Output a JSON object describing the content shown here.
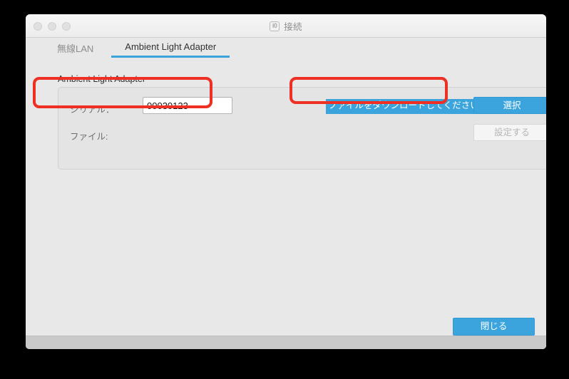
{
  "window": {
    "title": "接続",
    "title_icon": "app-window-icon",
    "traffic_lights": [
      "close-button",
      "minimize-button",
      "maximize-button"
    ]
  },
  "tabs": [
    {
      "label": "無線LAN",
      "active": false
    },
    {
      "label": "Ambient Light Adapter",
      "active": true
    }
  ],
  "section": {
    "title": "Ambient Light Adapter"
  },
  "form": {
    "serial": {
      "label": "シリアル：",
      "value": "00030123",
      "placeholder": ""
    },
    "file": {
      "label": "ファイル:",
      "value": ""
    },
    "message": "ファイルをダウンロードしてください",
    "select_button": "選択",
    "apply_button": "設定する",
    "apply_enabled": false
  },
  "footer": {
    "close_button": "閉じる"
  },
  "colors": {
    "accent": "#3ba4dd",
    "annotation": "#ee2f24",
    "window_bg": "#e8e8e8",
    "group_bg": "#e4e4e4",
    "footer_bg": "#c9c9c9",
    "disabled_text": "#b6b6b6"
  }
}
